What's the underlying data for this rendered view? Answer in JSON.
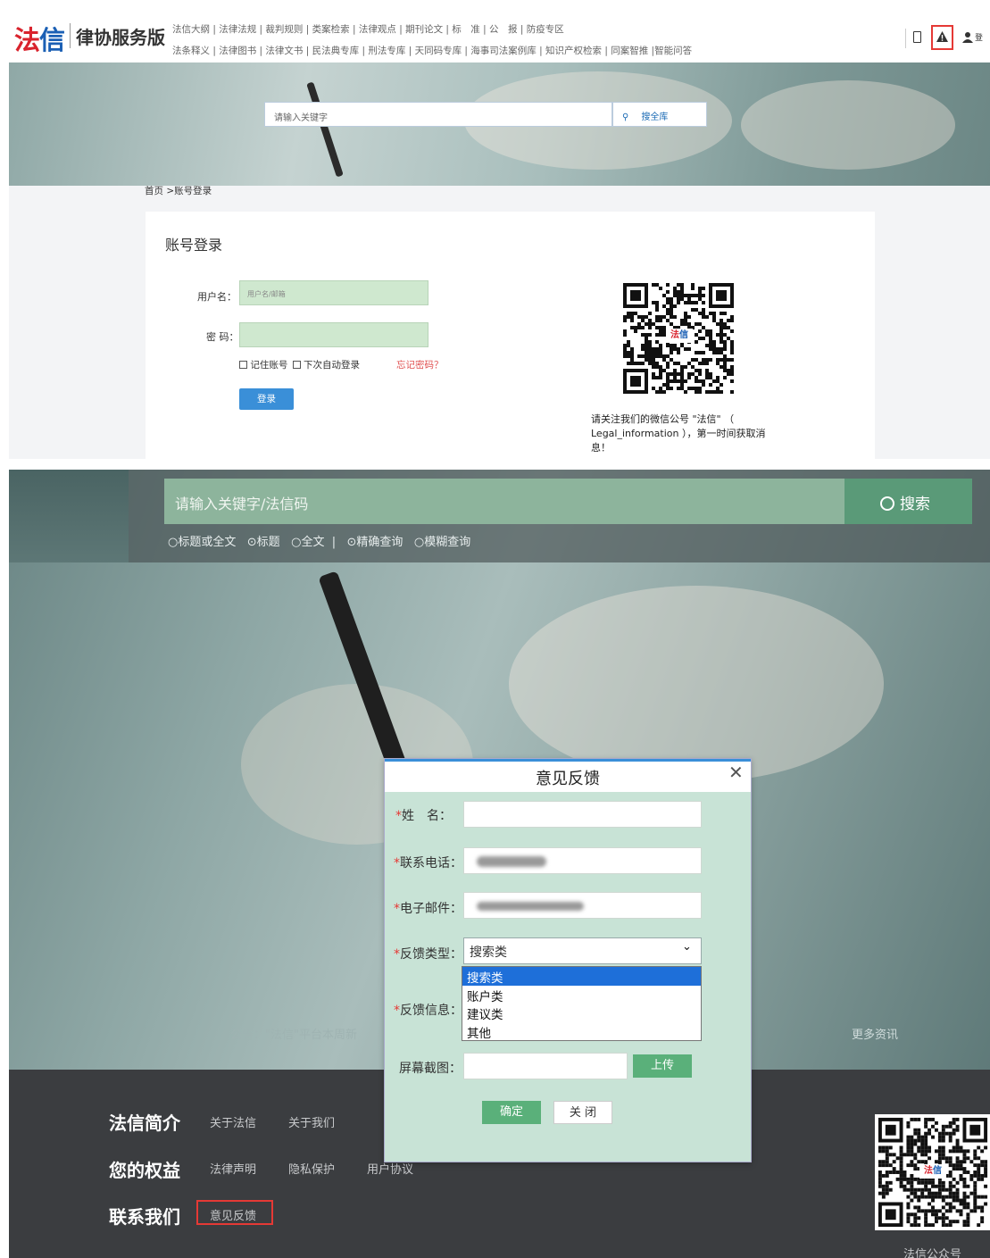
{
  "top": {
    "logo_main": "法信",
    "logo_sub": "律协服务版",
    "nav_row1": "法信大纲 | 法律法规 | 裁判规则 | 类案检索 | 法律观点 | 期刊论文 | 标　准 | 公　报 | 防疫专区",
    "nav_row2": "法条释义 | 法律图书 | 法律文书 | 民法典专库 | 刑法专库 | 天同码专库 | 海事司法案例库 | 知识产权检索 | 同案智推 |智能问答",
    "icon_mobile": "mobile-icon",
    "icon_warning": "warning-icon",
    "icon_user": "user-icon",
    "login_link": "登",
    "search_placeholder": "请输入关键字",
    "search_button": "搜全库",
    "breadcrumb": "首页 >账号登录",
    "login_title": "账号登录",
    "username_label": "用户名：",
    "username_placeholder": "用户名/邮箱",
    "password_label": "密 码：",
    "remember_account": "记住账号",
    "auto_login": "下次自动登录",
    "forgot": "忘记密码？",
    "login_button": "登录",
    "qr_logo": "法信",
    "qr_text": "请关注我们的微信公号 \"法信\" （ Legal_information ），第一时间获取消息！"
  },
  "bottom": {
    "search_placeholder": "请输入关键字/法信码",
    "search_button": "搜索",
    "radios": [
      "标题或全文",
      "标题",
      "全文",
      "精确查询",
      "模糊查询"
    ],
    "radio_separator": "|",
    "notice": "公告：\"法信\"平台本周新",
    "more_news": "更多资讯",
    "footer": {
      "intro_heading": "法信简介",
      "about_faxin": "关于法信",
      "about_us": "关于我们",
      "rights_heading": "您的权益",
      "legal_statement": "法律声明",
      "privacy": "隐私保护",
      "user_agreement": "用户协议",
      "contact_heading": "联系我们",
      "feedback_link": "意见反馈",
      "qr_label": "法信公众号",
      "qr_logo": "法信"
    },
    "dialog": {
      "title": "意见反馈",
      "close": "✕",
      "required_mark": "*",
      "name_label": "姓　名：",
      "phone_label": "联系电话：",
      "email_label": "电子邮件：",
      "type_label": "反馈类型：",
      "type_selected": "搜索类",
      "type_options": [
        "搜索类",
        "账户类",
        "建议类",
        "其他"
      ],
      "message_label": "反馈信息：",
      "screenshot_label": "屏幕截图：",
      "upload_button": "上传",
      "ok_button": "确定",
      "close_button": "关 闭"
    }
  },
  "colors": {
    "brand_blue": "#1a5fb4",
    "brand_red": "#d9232d",
    "highlight_red": "#e53935",
    "green_button": "#5ab07a",
    "select_blue": "#1e6fd9"
  }
}
